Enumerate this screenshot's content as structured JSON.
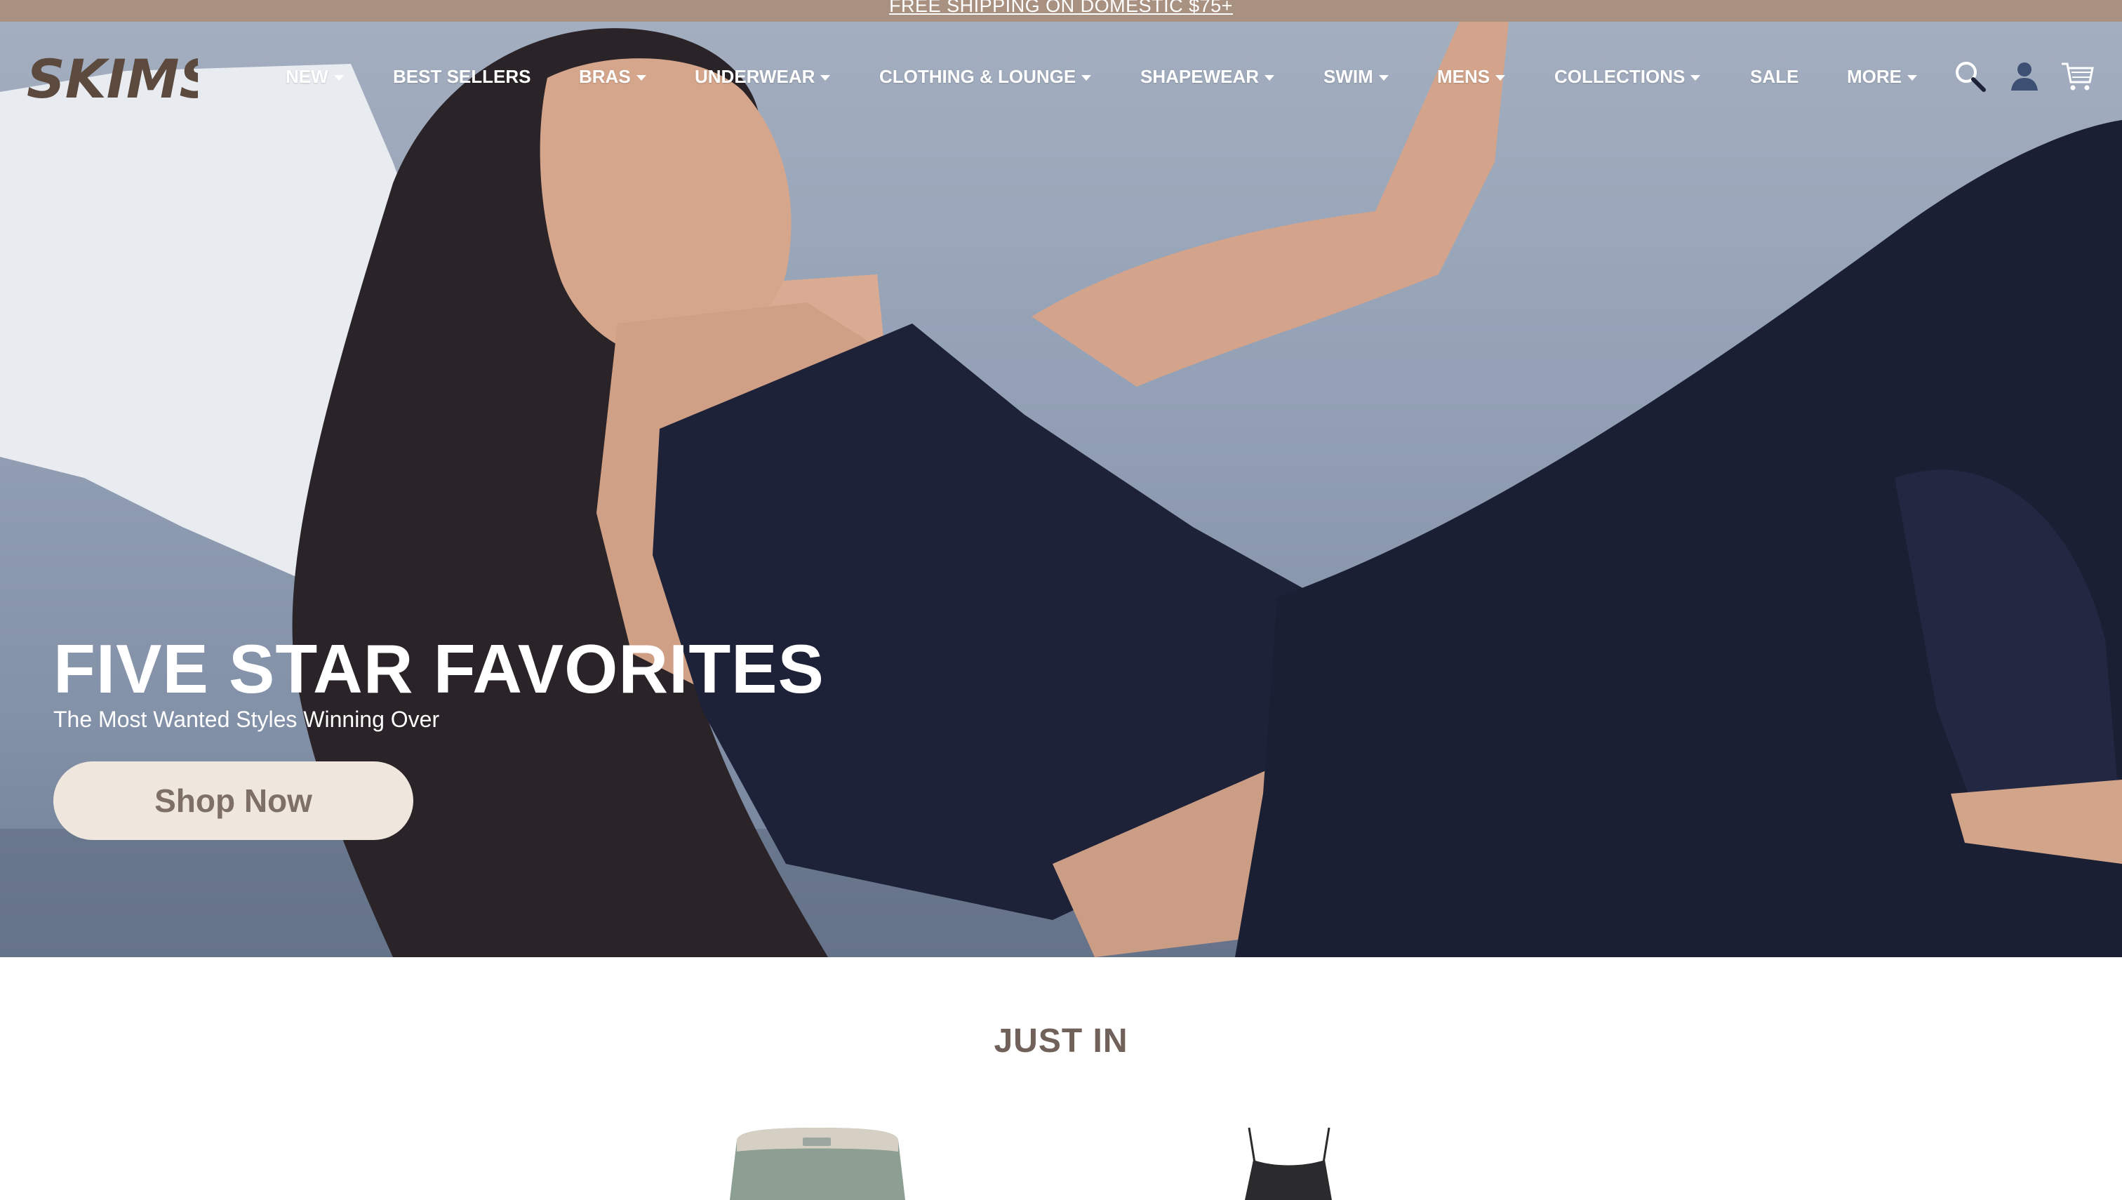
{
  "promo": {
    "text": "FREE SHIPPING ON DOMESTIC $75+"
  },
  "brand": {
    "logo_text": "SKIMS",
    "logo_color": "#5c4a3f"
  },
  "nav": {
    "items": [
      {
        "label": "NEW",
        "has_dropdown": true
      },
      {
        "label": "BEST SELLERS",
        "has_dropdown": false
      },
      {
        "label": "BRAS",
        "has_dropdown": true
      },
      {
        "label": "UNDERWEAR",
        "has_dropdown": true
      },
      {
        "label": "CLOTHING & LOUNGE",
        "has_dropdown": true
      },
      {
        "label": "SHAPEWEAR",
        "has_dropdown": true
      },
      {
        "label": "SWIM",
        "has_dropdown": true
      },
      {
        "label": "MENS",
        "has_dropdown": true
      },
      {
        "label": "COLLECTIONS",
        "has_dropdown": true
      },
      {
        "label": "SALE",
        "has_dropdown": false
      },
      {
        "label": "MORE",
        "has_dropdown": true
      }
    ],
    "icons": [
      "search-icon",
      "account-icon",
      "cart-icon"
    ]
  },
  "hero": {
    "title": "FIVE STAR FAVORITES",
    "subtitle": "The Most Wanted Styles Winning Over",
    "cta_label": "Shop Now"
  },
  "just_in": {
    "heading": "JUST IN",
    "products": [
      {
        "name": "sage-shorts",
        "color": "#8d9e93"
      },
      {
        "name": "black-cami",
        "color": "#2b2b2d"
      }
    ]
  },
  "colors": {
    "promo_bar": "#a89181",
    "cta_bg": "#efe7dd",
    "cta_text": "#7e7066",
    "heading": "#70625a"
  }
}
